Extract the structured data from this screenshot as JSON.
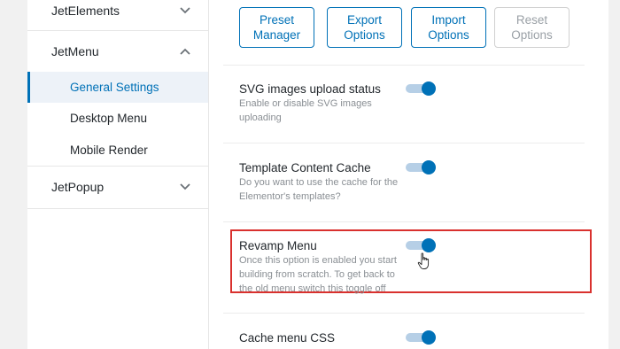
{
  "sidebar": {
    "groups": [
      {
        "label": "JetElements",
        "expanded": false
      },
      {
        "label": "JetMenu",
        "expanded": true,
        "items": [
          {
            "label": "General Settings",
            "active": true
          },
          {
            "label": "Desktop Menu"
          },
          {
            "label": "Mobile Render"
          }
        ]
      },
      {
        "label": "JetPopup",
        "expanded": false
      }
    ]
  },
  "toolbar": {
    "buttons": [
      {
        "label": "Preset Manager",
        "line1": "Preset",
        "line2": "Manager",
        "enabled": true
      },
      {
        "label": "Export Options",
        "line1": "Export",
        "line2": "Options",
        "enabled": true
      },
      {
        "label": "Import Options",
        "line1": "Import",
        "line2": "Options",
        "enabled": true
      },
      {
        "label": "Reset Options",
        "line1": "Reset",
        "line2": "Options",
        "enabled": false
      }
    ]
  },
  "settings": [
    {
      "title": "SVG images upload status",
      "description": "Enable or disable SVG images uploading",
      "enabled": true
    },
    {
      "title": "Template Content Cache",
      "description": "Do you want to use the cache for the Elementor's templates?",
      "enabled": true
    },
    {
      "title": "Revamp Menu",
      "description": "Once this option is enabled you start building from scratch. To get back to the old menu switch this toggle off",
      "enabled": true,
      "highlighted": true
    },
    {
      "title": "Cache menu CSS",
      "description": "",
      "enabled": true
    }
  ],
  "colors": {
    "accent": "#0071b7",
    "active_bg": "#edf2f8",
    "highlight_border": "#d9312e",
    "toggle_track": "#b6cfe6"
  }
}
